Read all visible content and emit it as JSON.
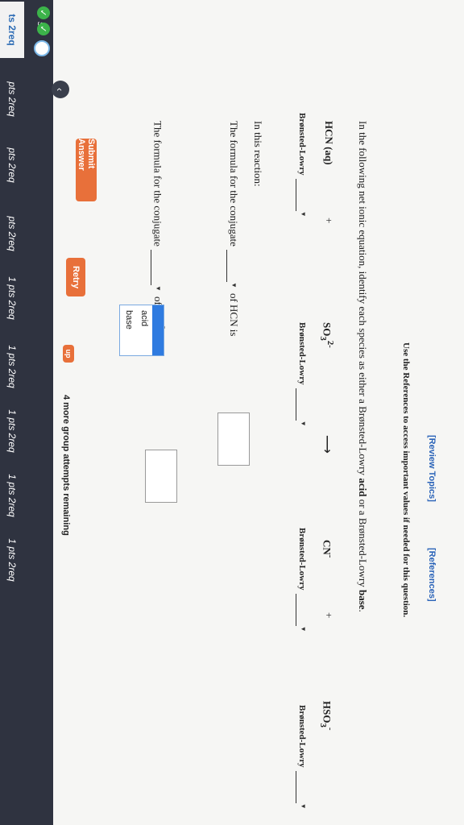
{
  "links": {
    "review_topics": "[Review Topics]",
    "references": "[References]"
  },
  "instruction": "Use the References to access important values if needed for this question.",
  "question": {
    "prefix": "In the following net ionic equation, identify each species as either a Brønsted-Lowry ",
    "acid_word": "acid",
    "middle": " or a Brønsted-Lowry ",
    "base_word": "base",
    "suffix": "."
  },
  "equation": {
    "species": [
      {
        "base": "HCN",
        "sub": "",
        "sup": "",
        "state": " (aq)"
      },
      {
        "base": "SO",
        "sub": "3",
        "sup": "2-",
        "state": ""
      },
      {
        "base": "CN",
        "sub": "",
        "sup": "-",
        "state": ""
      },
      {
        "base": "HSO",
        "sub": "3",
        "sup": "-",
        "state": ""
      }
    ],
    "plus": "+",
    "arrow": "⟶",
    "label": "Brønsted-Lowry"
  },
  "reaction": {
    "heading": "In this reaction:",
    "line1_start": "The formula for the conjugate",
    "line1_mid": "of HCN is",
    "line2_start": "The formula for the conjugate",
    "line2_mid": "of SO",
    "line2_sub": "3",
    "line2_sup": "2-",
    "line2_end": " is"
  },
  "dropdown": {
    "options": [
      "acid",
      "base"
    ]
  },
  "buttons": {
    "submit": "Submit Answer",
    "retry": "Retry",
    "retry_suffix": "up"
  },
  "attempts": "4 more group attempts remaining",
  "sidebar": {
    "items": [
      "s",
      "ts 2req",
      "pts 2req",
      "pts 2req",
      "pts 2req",
      "1 pts 2req",
      "1 pts 2req",
      "1 pts 2req",
      "1 pts 2req",
      "1 pts 2req"
    ]
  },
  "colors": {
    "accent": "#e8703a",
    "link": "#2a63b8",
    "sidebar": "#2f3340",
    "highlight": "#2f7be0",
    "check": "#3cb34a"
  }
}
